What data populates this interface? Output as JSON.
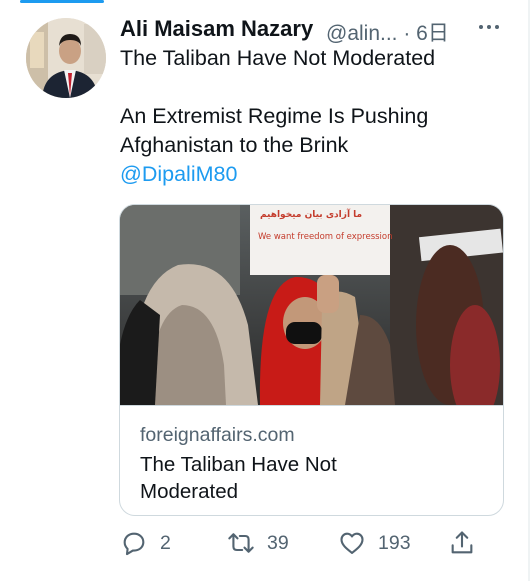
{
  "tweet": {
    "author_name": "Ali Maisam Nazary",
    "handle_time": "@alin... · 6日",
    "text_lines": [
      "The Taliban Have Not Moderated",
      "",
      "An Extremist Regime Is Pushing",
      "Afghanistan to the Brink"
    ],
    "mention": "@DipaliM80"
  },
  "card": {
    "image_sign_text": "We want freedom of expression",
    "domain": "foreignaffairs.com",
    "title_lines": [
      "The Taliban Have Not",
      "Moderated"
    ]
  },
  "actions": {
    "reply_count": "2",
    "retweet_count": "39",
    "like_count": "193"
  },
  "colors": {
    "accent": "#1d9bf0",
    "text_primary": "#0f1419",
    "text_secondary": "#536471",
    "border": "#cfd9de"
  },
  "icons": [
    "more-icon",
    "reply-icon",
    "retweet-icon",
    "like-icon",
    "share-icon"
  ]
}
